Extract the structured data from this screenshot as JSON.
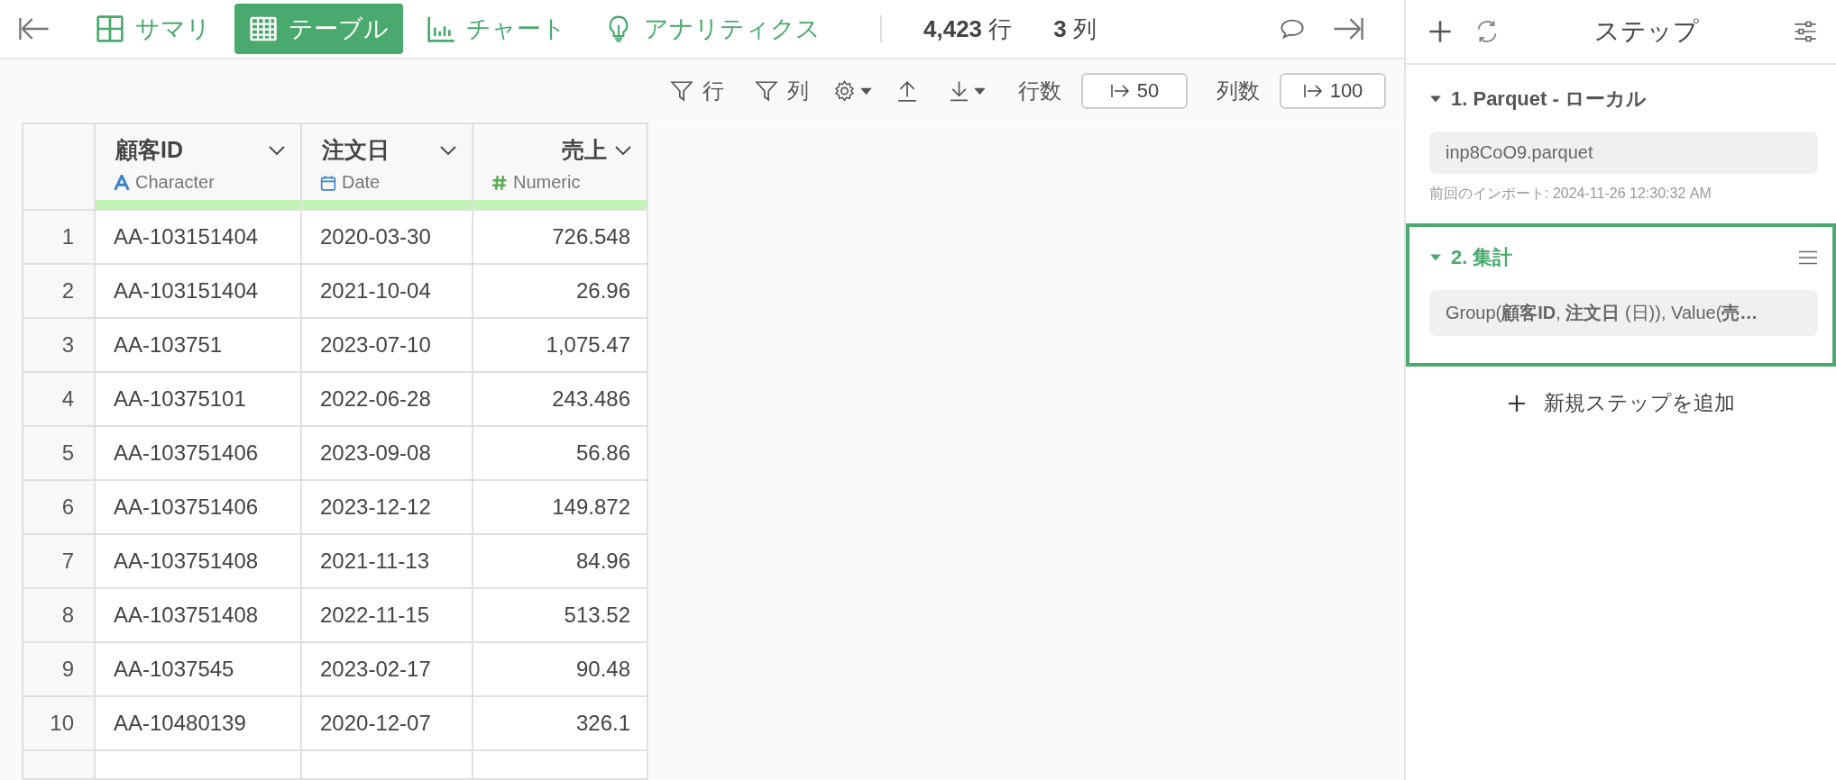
{
  "view_tabs": [
    {
      "label": "サマリ",
      "kind": "summary",
      "selected": false
    },
    {
      "label": "テーブル",
      "kind": "table",
      "selected": true
    },
    {
      "label": "チャート",
      "kind": "chart",
      "selected": false
    },
    {
      "label": "アナリティクス",
      "kind": "analytics",
      "selected": false
    }
  ],
  "stats": [
    {
      "value": "4,423",
      "unit": "行"
    },
    {
      "value": "3",
      "unit": "列"
    }
  ],
  "toolbar": {
    "row_filter": "行",
    "column_filter": "列",
    "row_limit_label": "行数",
    "row_limit": "50",
    "column_limit_label": "列数",
    "column_limit": "100"
  },
  "table": {
    "columns": [
      {
        "name": "顧客ID",
        "type": "Character",
        "kind": "character"
      },
      {
        "name": "注文日",
        "type": "Date",
        "kind": "date"
      },
      {
        "name": "売上",
        "type": "Numeric",
        "kind": "numeric"
      }
    ],
    "rows": [
      {
        "index": "1",
        "cells": [
          "AA-103151404",
          "2020-03-30",
          "726.548"
        ]
      },
      {
        "index": "2",
        "cells": [
          "AA-103151404",
          "2021-10-04",
          "26.96"
        ]
      },
      {
        "index": "3",
        "cells": [
          "AA-103751",
          "2023-07-10",
          "1,075.47"
        ]
      },
      {
        "index": "4",
        "cells": [
          "AA-10375101",
          "2022-06-28",
          "243.486"
        ]
      },
      {
        "index": "5",
        "cells": [
          "AA-103751406",
          "2023-09-08",
          "56.86"
        ]
      },
      {
        "index": "6",
        "cells": [
          "AA-103751406",
          "2023-12-12",
          "149.872"
        ]
      },
      {
        "index": "7",
        "cells": [
          "AA-103751408",
          "2021-11-13",
          "84.96"
        ]
      },
      {
        "index": "8",
        "cells": [
          "AA-103751408",
          "2022-11-15",
          "513.52"
        ]
      },
      {
        "index": "9",
        "cells": [
          "AA-1037545",
          "2023-02-17",
          "90.48"
        ]
      },
      {
        "index": "10",
        "cells": [
          "AA-10480139",
          "2020-12-07",
          "326.1"
        ]
      }
    ]
  },
  "steps_panel": {
    "title": "ステップ",
    "steps": [
      {
        "title": "1. Parquet - ローカル",
        "expanded": true,
        "selected": false,
        "detail": "inp8CoO9.parquet",
        "note": "前回のインポート: 2024-11-26 12:30:32 AM"
      },
      {
        "title": "2. 集計",
        "expanded": true,
        "selected": true,
        "detail": "Group(**顧客ID**, **注文日** (日)), Value(**売…**"
      }
    ],
    "add_step": "新規ステップを追加"
  }
}
